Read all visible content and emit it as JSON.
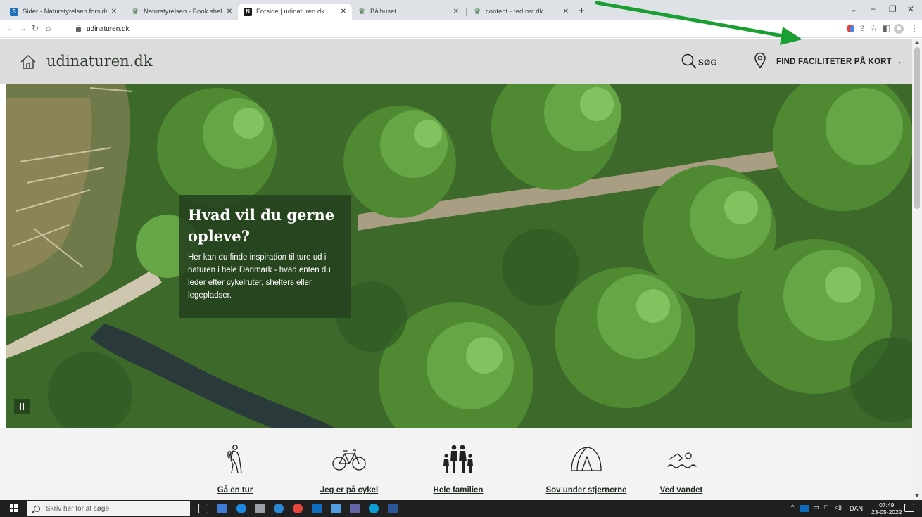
{
  "browser": {
    "tabs": [
      {
        "label": "Sider - Naturstyrelsen forside",
        "active": false
      },
      {
        "label": "Naturstyrelsen - Book shelters, le",
        "active": false
      },
      {
        "label": "Forside | udinaturen.dk",
        "active": true
      },
      {
        "label": "Bålhuset",
        "active": false
      },
      {
        "label": "content - red.nst.dk",
        "active": false
      }
    ],
    "url": "udinaturen.dk"
  },
  "site": {
    "logo_text": "udinaturen.dk",
    "search_label": "SØG",
    "map_link_label": "FIND FACILITETER PÅ KORT →"
  },
  "hero": {
    "title": "Hvad vil du gerne opleve?",
    "text": "Her kan du finde inspiration til ture ud i naturen i hele Danmark - hvad enten du leder efter cykelruter, shelters eller legepladser."
  },
  "categories": [
    {
      "label": "Gå en tur",
      "icon": "hiker-icon"
    },
    {
      "label": "Jeg er på cykel",
      "icon": "bicycle-icon"
    },
    {
      "label": "Hele familien",
      "icon": "family-icon"
    },
    {
      "label": "Sov under stjernerne",
      "icon": "tent-icon"
    },
    {
      "label": "Ved vandet",
      "icon": "swimmer-icon"
    }
  ],
  "taskbar": {
    "search_placeholder": "Skriv her for at søge",
    "language": "DAN",
    "time": "07:49",
    "date": "23-05-2022"
  },
  "colors": {
    "header_bg": "#dcdcdc",
    "hero_box_bg": "#24401e",
    "annotation_arrow": "#1aa032"
  }
}
